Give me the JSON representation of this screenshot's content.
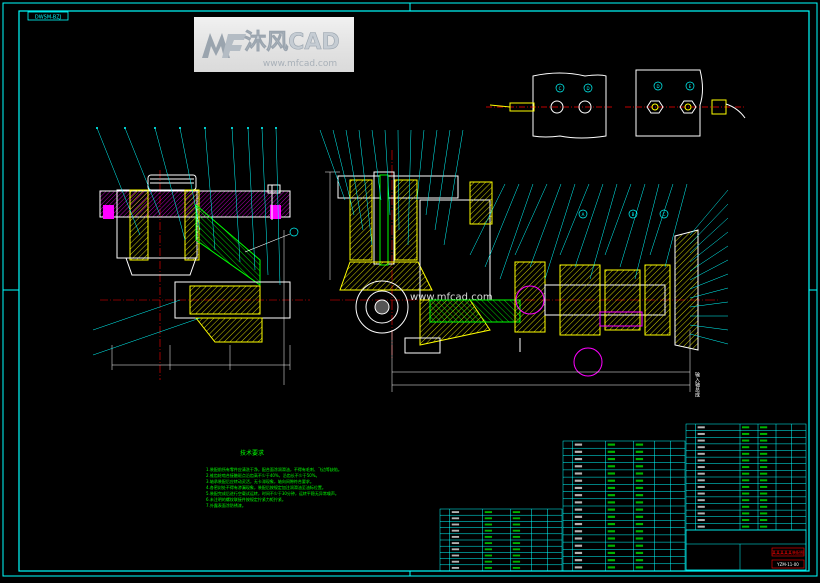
{
  "drawing": {
    "corner_code": "DWSM-BZJ",
    "sheet_title": "某某某某某装配图",
    "drawing_number": "YZM-11-00",
    "tech_req_title": "技术要求",
    "tech_req_lines": [
      "1.装配前所有零件应清洗干净，配合面涂润滑油，不得有毛刺、飞边等缺陷。",
      "2.锥齿轮啮合接触斑点沿齿高不少于40%，沿齿长不少于50%。",
      "3.轴承装配后应转动灵活，无卡滞现象，轴向间隙符合要求。",
      "4.各密封处不得有渗漏现象，装配后按规定加注润滑油至油标位置。",
      "5.装配完成后进行空载试运转，时间不少于30分钟，运转平稳无异常噪声。",
      "6.未注明的螺纹联接件按规定拧紧力矩拧紧。",
      "7.外露表面涂防锈漆。"
    ],
    "detail_labels": [
      "C",
      "D",
      "D",
      "E"
    ],
    "section_labels": [
      "A",
      "B",
      "C"
    ],
    "vertical_note": "输入轴总成",
    "parts_list_rows": 18,
    "watermark": {
      "brand": "沐风CAD",
      "url": "www.mfcad.com",
      "center_text": "www.mfcad.com"
    }
  },
  "colors": {
    "frame": "#00ffff",
    "outline": "#ffffff",
    "part_yellow": "#ffff00",
    "hatch_green": "#00ff00",
    "callout_cyan": "#00ffff",
    "accent_red": "#ff0000",
    "accent_magenta": "#ff00ff",
    "accent_blue": "#3060ff"
  }
}
